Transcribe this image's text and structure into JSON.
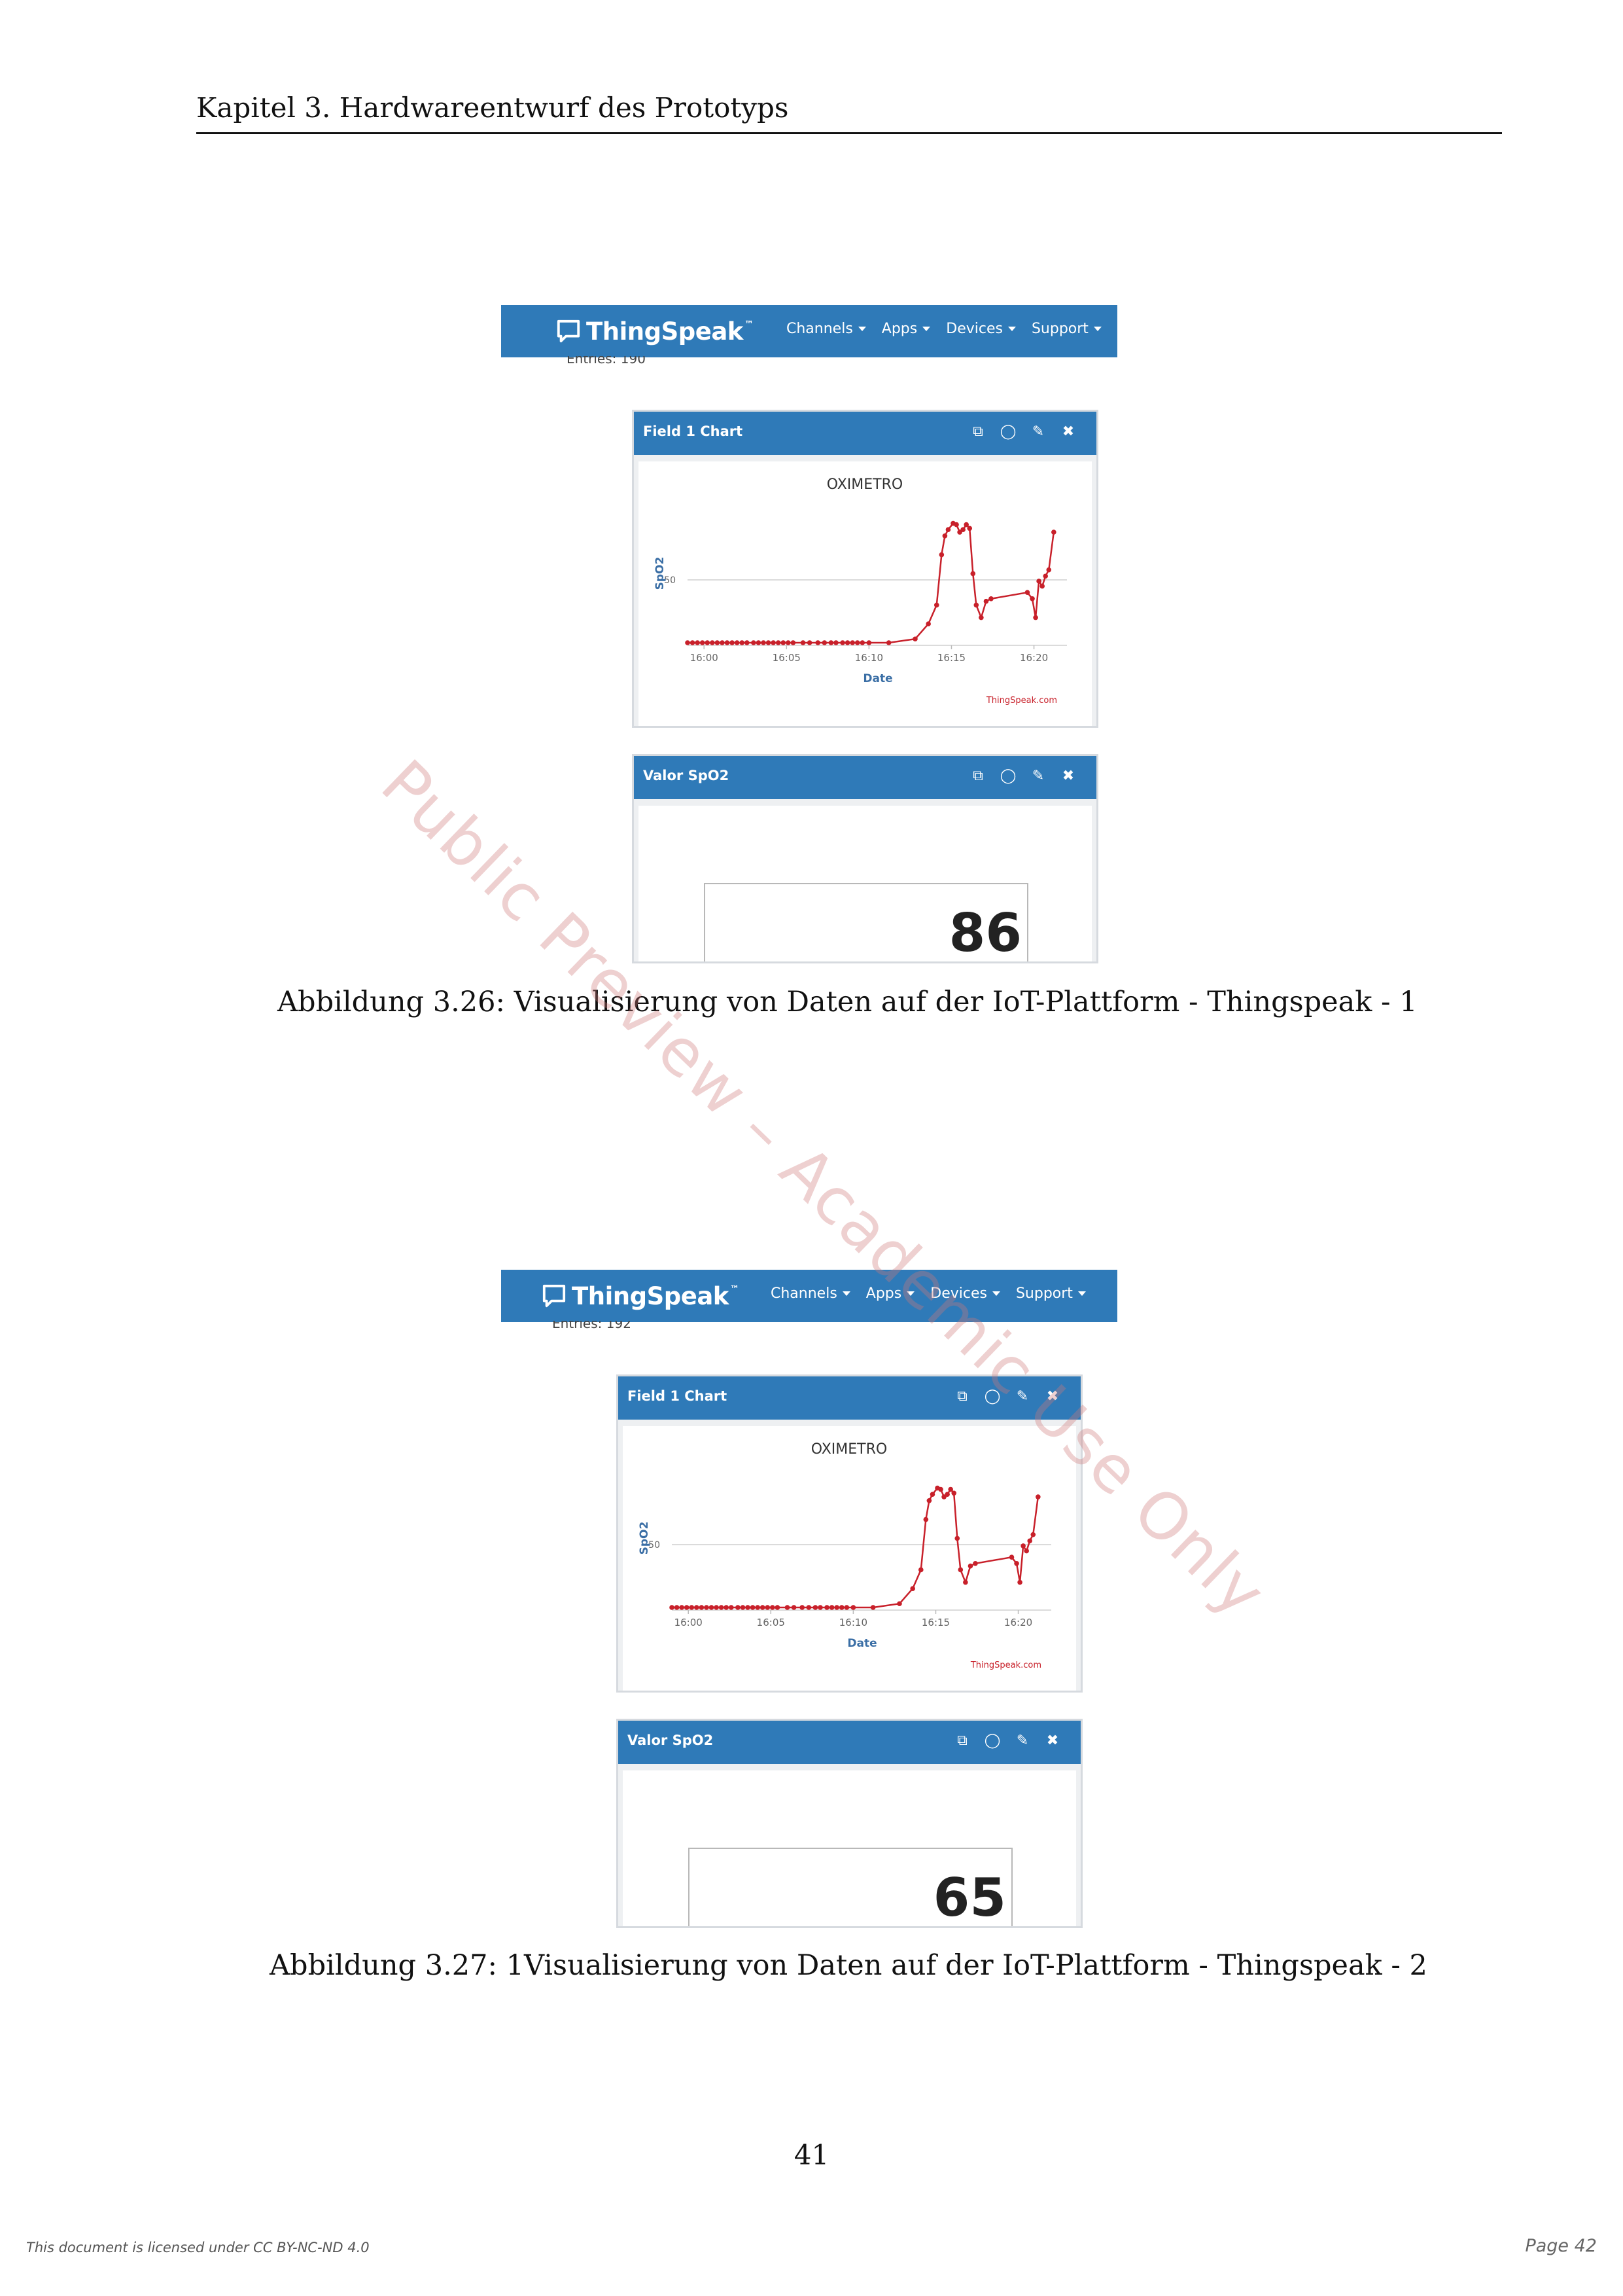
{
  "header": {
    "running_title": "Kapitel 3.  Hardwareentwurf des Prototyps"
  },
  "figures": [
    {
      "navbar": {
        "brand": "ThingSpeak",
        "trademark": "™",
        "menu": [
          "Channels",
          "Apps",
          "Devices",
          "Support"
        ]
      },
      "entries_text": "Entries: 190",
      "chart_widget": {
        "title": "Field 1 Chart",
        "icons": [
          "external-link-icon",
          "comment-icon",
          "pencil-icon",
          "close-icon"
        ],
        "chart": {
          "title": "OXIMETRO",
          "ylabel": "SpO2",
          "xlabel": "Date",
          "credit": "ThingSpeak.com"
        }
      },
      "value_widget": {
        "title": "Valor SpO2",
        "value": "86"
      },
      "caption": "Abbildung 3.26: Visualisierung von Daten auf der IoT-Plattform - Thingspeak - 1"
    },
    {
      "navbar": {
        "brand": "ThingSpeak",
        "trademark": "™",
        "menu": [
          "Channels",
          "Apps",
          "Devices",
          "Support"
        ]
      },
      "entries_text": "Entries: 192",
      "chart_widget": {
        "title": "Field 1 Chart",
        "icons": [
          "external-link-icon",
          "comment-icon",
          "pencil-icon",
          "close-icon"
        ],
        "chart": {
          "title": "OXIMETRO",
          "ylabel": "SpO2",
          "xlabel": "Date",
          "credit": "ThingSpeak.com"
        }
      },
      "value_widget": {
        "title": "Valor SpO2",
        "value": "65"
      },
      "caption": "Abbildung 3.27: 1Visualisierung von Daten auf der IoT-Plattform - Thingspeak - 2"
    }
  ],
  "chart_data": [
    {
      "type": "line",
      "title": "OXIMETRO",
      "xlabel": "Date",
      "ylabel": "SpO2",
      "x_ticks": [
        "16:00",
        "16:05",
        "16:10",
        "16:15",
        "16:20"
      ],
      "y_ticks": [
        50
      ],
      "x_unit": "minutes after 16:00",
      "ylim": [
        0,
        100
      ],
      "xlim": [
        -1,
        22
      ],
      "series": [
        {
          "color": "#c8202a",
          "x": [
            -1,
            -0.7,
            -0.4,
            -0.1,
            0.2,
            0.5,
            0.8,
            1.1,
            1.4,
            1.7,
            2.0,
            2.3,
            2.6,
            3.0,
            3.3,
            3.6,
            3.9,
            4.2,
            4.5,
            4.8,
            5.1,
            5.4,
            6.0,
            6.4,
            6.9,
            7.3,
            7.7,
            8.0,
            8.4,
            8.7,
            9.0,
            9.3,
            9.6,
            10.0,
            11.2,
            12.8,
            13.6,
            14.1,
            14.4,
            14.6,
            14.8,
            15.1,
            15.3,
            15.5,
            15.7,
            15.9,
            16.1,
            16.3,
            16.5,
            16.8,
            17.1,
            17.4,
            19.6,
            19.9,
            20.1,
            20.3,
            20.5,
            20.7,
            20.9,
            21.2
          ],
          "y": [
            0,
            0,
            0,
            0,
            0,
            0,
            0,
            0,
            0,
            0,
            0,
            0,
            0,
            0,
            0,
            0,
            0,
            0,
            0,
            0,
            0,
            0,
            0,
            0,
            0,
            0,
            0,
            0,
            0,
            0,
            0,
            0,
            0,
            0,
            0,
            3,
            15,
            30,
            70,
            85,
            90,
            95,
            94,
            88,
            90,
            94,
            91,
            55,
            30,
            20,
            33,
            35,
            40,
            35,
            20,
            49,
            45,
            53,
            58,
            88
          ]
        }
      ]
    },
    {
      "type": "line",
      "title": "OXIMETRO",
      "xlabel": "Date",
      "ylabel": "SpO2",
      "x_ticks": [
        "16:00",
        "16:05",
        "16:10",
        "16:15",
        "16:20"
      ],
      "y_ticks": [
        50
      ],
      "x_unit": "minutes after 16:00",
      "ylim": [
        0,
        100
      ],
      "xlim": [
        -1,
        22
      ],
      "series": [
        {
          "color": "#c8202a",
          "x": [
            -1,
            -0.7,
            -0.4,
            -0.1,
            0.2,
            0.5,
            0.8,
            1.1,
            1.4,
            1.7,
            2.0,
            2.3,
            2.6,
            3.0,
            3.3,
            3.6,
            3.9,
            4.2,
            4.5,
            4.8,
            5.1,
            5.4,
            6.0,
            6.4,
            6.9,
            7.3,
            7.7,
            8.0,
            8.4,
            8.7,
            9.0,
            9.3,
            9.6,
            10.0,
            11.2,
            12.8,
            13.6,
            14.1,
            14.4,
            14.6,
            14.8,
            15.1,
            15.3,
            15.5,
            15.7,
            15.9,
            16.1,
            16.3,
            16.5,
            16.8,
            17.1,
            17.4,
            19.6,
            19.9,
            20.1,
            20.3,
            20.5,
            20.7,
            20.9,
            21.2
          ],
          "y": [
            0,
            0,
            0,
            0,
            0,
            0,
            0,
            0,
            0,
            0,
            0,
            0,
            0,
            0,
            0,
            0,
            0,
            0,
            0,
            0,
            0,
            0,
            0,
            0,
            0,
            0,
            0,
            0,
            0,
            0,
            0,
            0,
            0,
            0,
            0,
            3,
            15,
            30,
            70,
            85,
            90,
            95,
            94,
            88,
            90,
            94,
            91,
            55,
            30,
            20,
            33,
            35,
            40,
            35,
            20,
            49,
            45,
            53,
            58,
            88
          ]
        }
      ]
    }
  ],
  "page_number": "41",
  "footer": {
    "license": "This document is licensed under CC BY-NC-ND 4.0",
    "page_label": "Page 42"
  },
  "watermark": "Public Preview – Academic Use Only",
  "colors": {
    "thingspeak_blue": "#2f7ab8",
    "series_red": "#c8202a"
  }
}
